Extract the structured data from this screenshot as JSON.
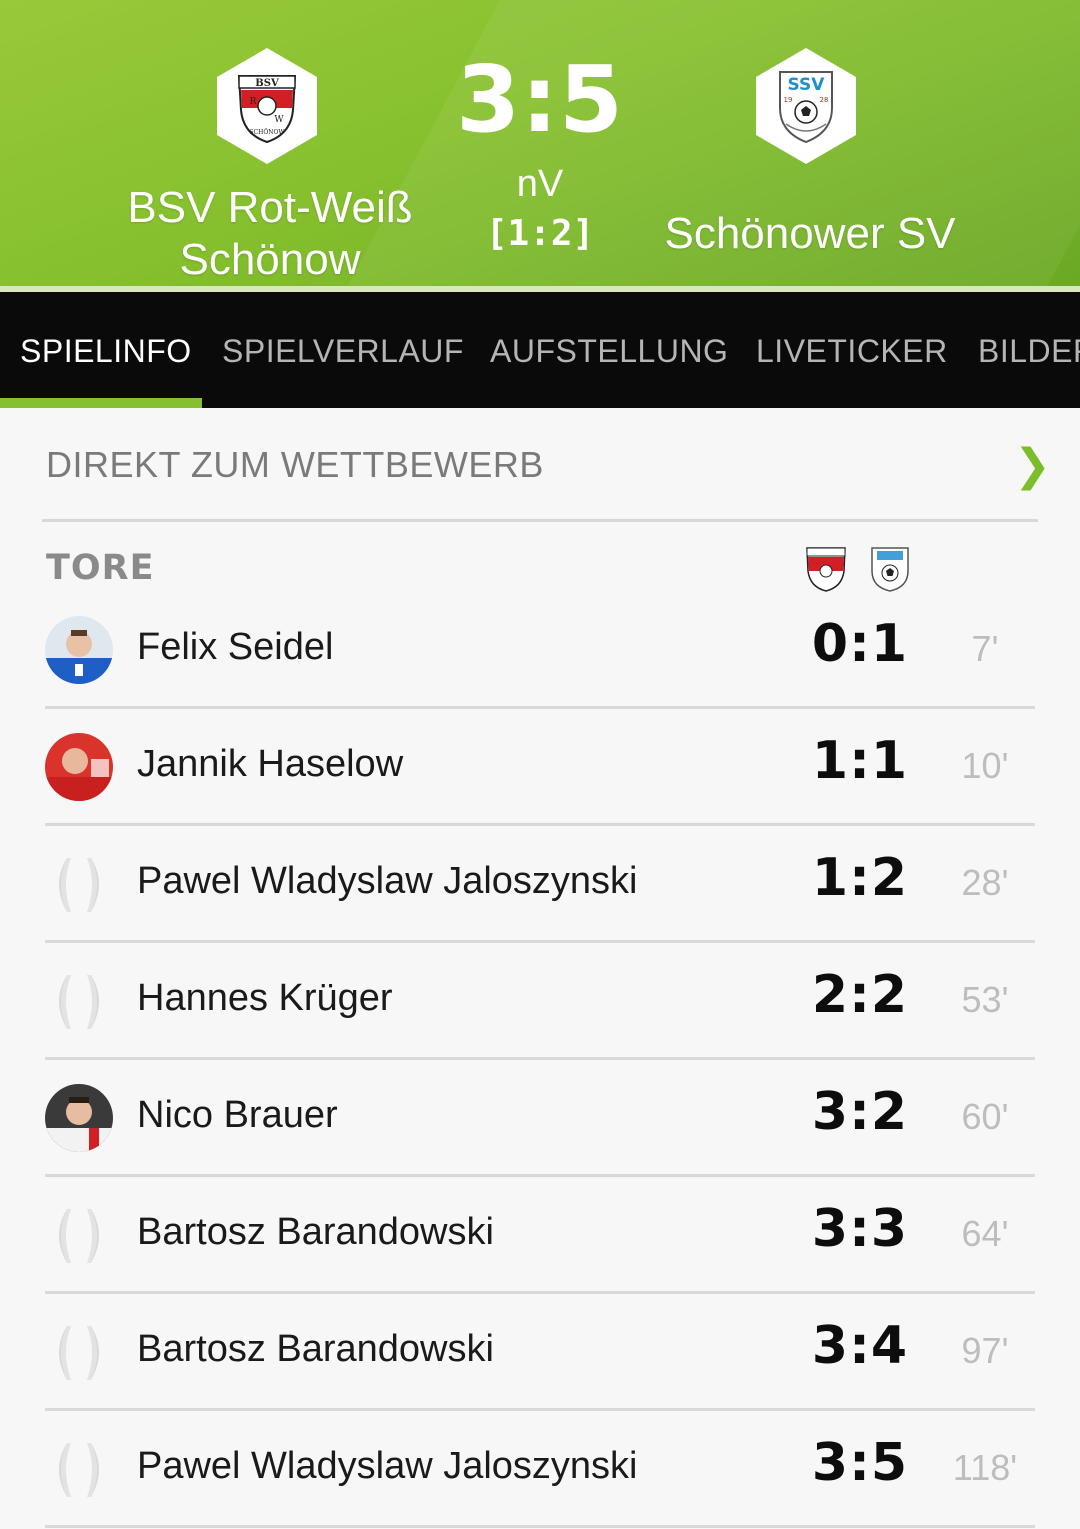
{
  "match": {
    "home_team": "BSV Rot-Weiß Schönow",
    "away_team": "Schönower SV",
    "score": "3:5",
    "note": "nV",
    "halftime": "[1:2]",
    "home_crest_text": [
      "BSV",
      "R",
      "W",
      "SCHÖNOW"
    ],
    "away_crest_text": [
      "SSV",
      "19",
      "28"
    ]
  },
  "tabs": [
    {
      "label": "SPIELINFO",
      "active": true
    },
    {
      "label": "SPIELVERLAUF",
      "active": false
    },
    {
      "label": "AUFSTELLUNG",
      "active": false
    },
    {
      "label": "LIVETICKER",
      "active": false
    },
    {
      "label": "BILDER",
      "active": false
    }
  ],
  "direct_link": {
    "label": "DIREKT ZUM WETTBEWERB",
    "chevron_icon": "chevron-right-icon"
  },
  "goals_section": {
    "title": "TORE"
  },
  "goals": [
    {
      "player": "Felix Seidel",
      "score": "0:1",
      "minute": "7'",
      "avatar": "photo-blue-kit"
    },
    {
      "player": "Jannik Haselow",
      "score": "1:1",
      "minute": "10'",
      "avatar": "photo-red-kit"
    },
    {
      "player": "Pawel Wladyslaw Jaloszynski",
      "score": "1:2",
      "minute": "28'",
      "avatar": "placeholder"
    },
    {
      "player": "Hannes Krüger",
      "score": "2:2",
      "minute": "53'",
      "avatar": "placeholder"
    },
    {
      "player": "Nico Brauer",
      "score": "3:2",
      "minute": "60'",
      "avatar": "photo-white-kit"
    },
    {
      "player": "Bartosz Barandowski",
      "score": "3:3",
      "minute": "64'",
      "avatar": "placeholder"
    },
    {
      "player": "Bartosz Barandowski",
      "score": "3:4",
      "minute": "97'",
      "avatar": "placeholder"
    },
    {
      "player": "Pawel Wladyslaw Jaloszynski",
      "score": "3:5",
      "minute": "118'",
      "avatar": "placeholder"
    }
  ],
  "colors": {
    "accent": "#86c02e",
    "tab_bar": "#0a0a0a",
    "home_red": "#d21f26",
    "away_blue": "#1f8fd0"
  }
}
